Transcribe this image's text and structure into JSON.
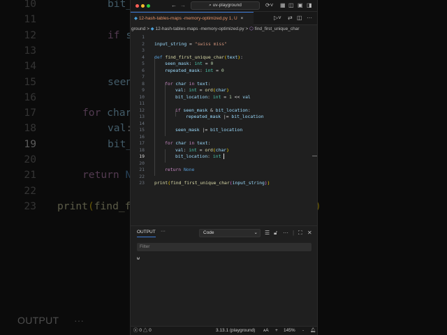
{
  "window": {
    "search": "uv-playground"
  },
  "tab": {
    "filename": "12-hash-tables-maps -memory-optimized.py",
    "badge": "1, U",
    "close": "×"
  },
  "breadcrumb": {
    "folder": "ground",
    "sep": ">",
    "file": "12-hash-tables-maps -memory-optimized.py",
    "symbol": "find_first_unique_char"
  },
  "code": {
    "current_line": 19,
    "lines": [
      {
        "n": "1",
        "indent": 0,
        "tokens": []
      },
      {
        "n": "2",
        "indent": 0,
        "tokens": [
          [
            "input_string",
            "var"
          ],
          [
            " = ",
            "op"
          ],
          [
            "\"swiss miss\"",
            "str"
          ]
        ]
      },
      {
        "n": "3",
        "indent": 0,
        "tokens": []
      },
      {
        "n": "4",
        "indent": 0,
        "tokens": [
          [
            "def ",
            "def"
          ],
          [
            "find_first_unique_char",
            "fn"
          ],
          [
            "(",
            "br"
          ],
          [
            "text",
            "var"
          ],
          [
            ")",
            "br"
          ],
          [
            ":",
            "op"
          ]
        ]
      },
      {
        "n": "5",
        "indent": 1,
        "tokens": [
          [
            "seen_mask",
            "var"
          ],
          [
            ": ",
            "op"
          ],
          [
            "int",
            "ty"
          ],
          [
            " = ",
            "op"
          ],
          [
            "0",
            "num"
          ]
        ]
      },
      {
        "n": "6",
        "indent": 1,
        "tokens": [
          [
            "repeated_mask",
            "var"
          ],
          [
            ": ",
            "op"
          ],
          [
            "int",
            "ty"
          ],
          [
            " = ",
            "op"
          ],
          [
            "0",
            "num"
          ]
        ]
      },
      {
        "n": "7",
        "indent": 0,
        "tokens": []
      },
      {
        "n": "8",
        "indent": 1,
        "tokens": [
          [
            "for ",
            "kw"
          ],
          [
            "char",
            "var"
          ],
          [
            " in ",
            "kw"
          ],
          [
            "text",
            "var"
          ],
          [
            ":",
            "op"
          ]
        ]
      },
      {
        "n": "9",
        "indent": 2,
        "tokens": [
          [
            "val",
            "var"
          ],
          [
            ": ",
            "op"
          ],
          [
            "int",
            "ty"
          ],
          [
            " = ",
            "op"
          ],
          [
            "ord",
            "fn"
          ],
          [
            "(",
            "br"
          ],
          [
            "char",
            "var"
          ],
          [
            ")",
            "br"
          ]
        ]
      },
      {
        "n": "10",
        "indent": 2,
        "tokens": [
          [
            "bit_location",
            "var"
          ],
          [
            ": ",
            "op"
          ],
          [
            "int",
            "ty"
          ],
          [
            " = ",
            "op"
          ],
          [
            "1",
            "num"
          ],
          [
            " << ",
            "op"
          ],
          [
            "val",
            "var"
          ]
        ]
      },
      {
        "n": "11",
        "indent": 0,
        "tokens": []
      },
      {
        "n": "12",
        "indent": 2,
        "tokens": [
          [
            "if ",
            "kw"
          ],
          [
            "seen_mask",
            "var"
          ],
          [
            " & ",
            "op"
          ],
          [
            "bit_location",
            "var"
          ],
          [
            ":",
            "op"
          ]
        ]
      },
      {
        "n": "13",
        "indent": 3,
        "tokens": [
          [
            "repeated_mask",
            "var"
          ],
          [
            " |= ",
            "op"
          ],
          [
            "bit_location",
            "var"
          ]
        ]
      },
      {
        "n": "14",
        "indent": 0,
        "tokens": []
      },
      {
        "n": "15",
        "indent": 2,
        "tokens": [
          [
            "seen_mask",
            "var"
          ],
          [
            " |= ",
            "op"
          ],
          [
            "bit_location",
            "var"
          ]
        ]
      },
      {
        "n": "16",
        "indent": 0,
        "tokens": []
      },
      {
        "n": "17",
        "indent": 1,
        "tokens": [
          [
            "for ",
            "kw"
          ],
          [
            "char",
            "var"
          ],
          [
            " in ",
            "kw"
          ],
          [
            "text",
            "var"
          ],
          [
            ":",
            "op"
          ]
        ]
      },
      {
        "n": "18",
        "indent": 2,
        "tokens": [
          [
            "val",
            "var"
          ],
          [
            ": ",
            "op"
          ],
          [
            "int",
            "ty"
          ],
          [
            " = ",
            "op"
          ],
          [
            "ord",
            "fn"
          ],
          [
            "(",
            "br"
          ],
          [
            "char",
            "var"
          ],
          [
            ")",
            "br"
          ]
        ]
      },
      {
        "n": "19",
        "indent": 2,
        "tokens": [
          [
            "bit_location",
            "var"
          ],
          [
            ": ",
            "op"
          ],
          [
            "int ",
            "ty"
          ]
        ]
      },
      {
        "n": "20",
        "indent": 0,
        "tokens": []
      },
      {
        "n": "21",
        "indent": 1,
        "tokens": [
          [
            "return ",
            "kw"
          ],
          [
            "None",
            "def"
          ]
        ]
      },
      {
        "n": "22",
        "indent": 0,
        "tokens": []
      },
      {
        "n": "23",
        "indent": 0,
        "tokens": [
          [
            "print",
            "fn"
          ],
          [
            "(",
            "br"
          ],
          [
            "find_first_unique_char",
            "fn"
          ],
          [
            "(",
            "br2"
          ],
          [
            "input_string",
            "var"
          ],
          [
            ")",
            "br2"
          ],
          [
            ")",
            "br"
          ]
        ]
      }
    ]
  },
  "panel": {
    "tab": "OUTPUT",
    "more": "···",
    "channel": "Code",
    "filter_placeholder": "Filter",
    "output": "w"
  },
  "status": {
    "errors": "0",
    "warnings": "0",
    "python": "3.13.1 (playground)",
    "zoom_in": "+",
    "zoom": "145%",
    "zoom_out": "-"
  },
  "colors": {
    "accent": "#3c7ad6",
    "tab_text": "#e8946a",
    "editor_bg": "#1f1f1f"
  }
}
